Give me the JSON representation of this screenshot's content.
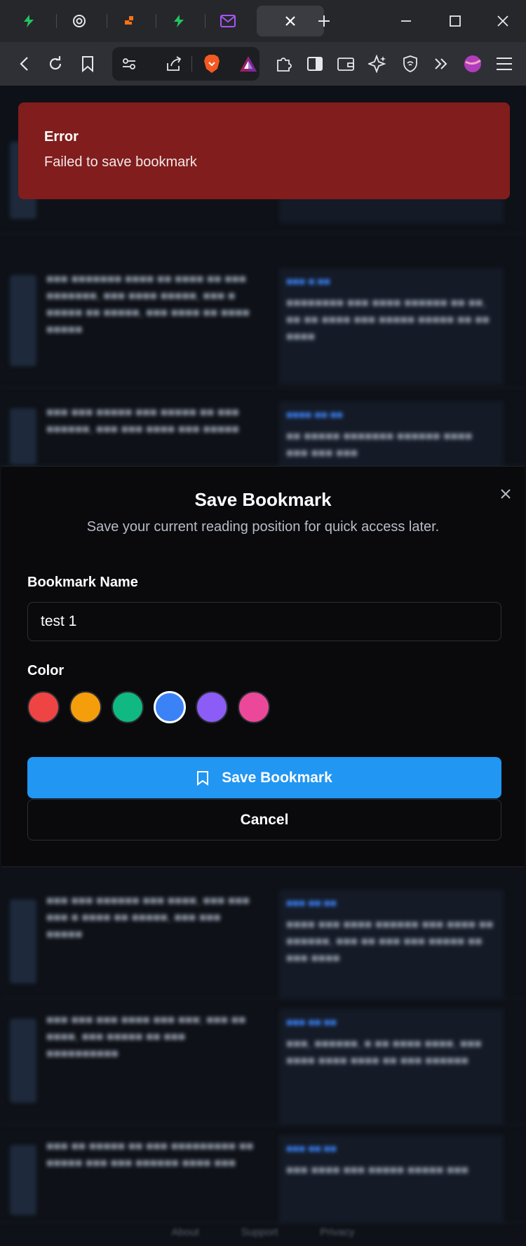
{
  "browser": {
    "tabs": [
      {
        "icon": "bolt-icon",
        "color": "#22c55e"
      },
      {
        "icon": "openai-icon",
        "color": "#e5e7eb"
      },
      {
        "icon": "squares-icon",
        "color": "#f97316"
      },
      {
        "icon": "bolt-icon",
        "color": "#22c55e"
      },
      {
        "icon": "mail-icon",
        "color": "#a855f7"
      }
    ],
    "active_tab_icon": "close-icon"
  },
  "toast": {
    "title": "Error",
    "message": "Failed to save bookmark",
    "color": "#811d1d"
  },
  "modal": {
    "title": "Save Bookmark",
    "subtitle": "Save your current reading position for quick access later.",
    "name_label": "Bookmark Name",
    "name_value": "test 1",
    "color_label": "Color",
    "colors": [
      "#ef4444",
      "#f59e0b",
      "#10b981",
      "#3b82f6",
      "#8b5cf6",
      "#ec4899"
    ],
    "selected_color": "#3b82f6",
    "save_label": "Save Bookmark",
    "cancel_label": "Cancel",
    "accent": "#2196f3"
  },
  "background_footer": [
    "About",
    "Support",
    "Privacy"
  ]
}
